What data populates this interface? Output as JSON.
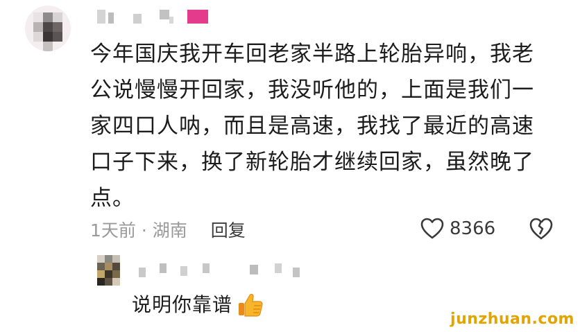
{
  "comment": {
    "text": "今年国庆我开车回老家半路上轮胎异响，我老公说慢慢开回家，我没听他的，上面是我们一家四口人呐，而且是高速，我找了最近的高速口子下来，换了新轮胎才继续回家，虽然晚了点。",
    "time_location": "1天前 · 湖南",
    "reply_label": "回复",
    "like_count": "8366",
    "icons": {
      "like": "heart-outline-icon",
      "dislike": "broken-heart-icon"
    }
  },
  "reply": {
    "text": "说明你靠谱",
    "icon": "thumbs-up-emoji"
  },
  "watermark": "junzhuan.com"
}
